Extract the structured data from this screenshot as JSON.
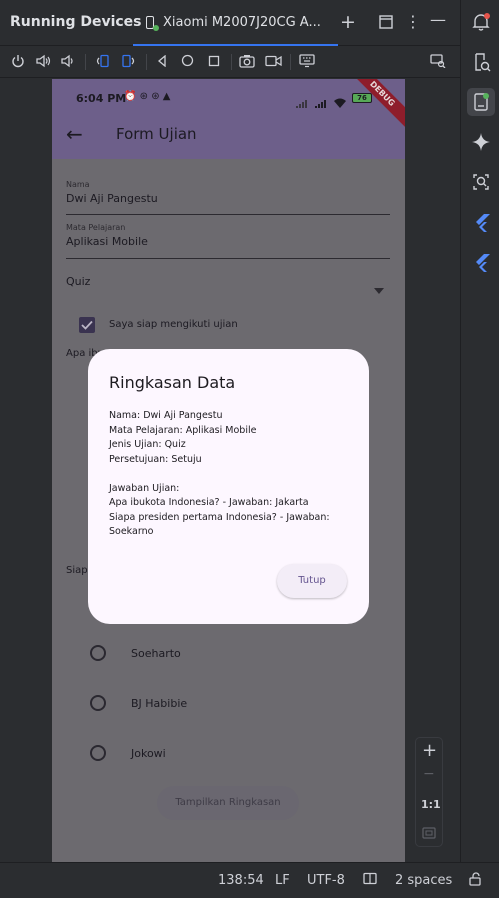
{
  "ide": {
    "panel_title": "Running Devices",
    "device_tab": "Xiaomi M2007J20CG A...",
    "new_tab_icon": "plus-icon",
    "accent": "#3574f0"
  },
  "toolbar": {
    "icons": [
      "power-icon",
      "volume-up-icon",
      "volume-down-icon",
      "rotate-left-icon",
      "rotate-right-icon",
      "back-icon",
      "home-icon",
      "overview-icon",
      "screenshot-icon",
      "screen-record-icon",
      "keyboard-icon",
      "device-mirror-icon"
    ]
  },
  "phone": {
    "status": {
      "time": "6:04 PM",
      "battery": "76"
    },
    "appbar": {
      "title": "Form Ujian",
      "color": "#6d5f8a"
    },
    "debug_banner": "DEBUG",
    "form": {
      "name_label": "Nama",
      "name_value": "Dwi Aji Pangestu",
      "subject_label": "Mata Pelajaran",
      "subject_value": "Aplikasi Mobile",
      "exam_type": "Quiz",
      "consent_label": "Saya siap mengikuti ujian",
      "consent_checked": true,
      "question1_partial": "Apa ibu",
      "question2_partial": "Siap",
      "options": [
        "Soeharto",
        "BJ Habibie",
        "Jokowi"
      ],
      "submit_label": "Tampilkan Ringkasan"
    },
    "dialog": {
      "title": "Ringkasan Data",
      "lines": [
        "Nama: Dwi Aji Pangestu",
        "Mata Pelajaran: Aplikasi Mobile",
        "Jenis Ujian: Quiz",
        "Persetujuan: Setuju",
        "",
        "Jawaban Ujian:",
        "Apa ibukota Indonesia? - Jawaban: Jakarta",
        "Siapa presiden pertama Indonesia? - Jawaban:",
        "Soekarno"
      ],
      "close_label": "Tutup"
    }
  },
  "zoom": {
    "plus": "+",
    "minus": "−",
    "ratio": "1:1"
  },
  "statusline": {
    "position": "138:54",
    "line_sep": "LF",
    "encoding": "UTF-8",
    "indent": "2 spaces"
  }
}
